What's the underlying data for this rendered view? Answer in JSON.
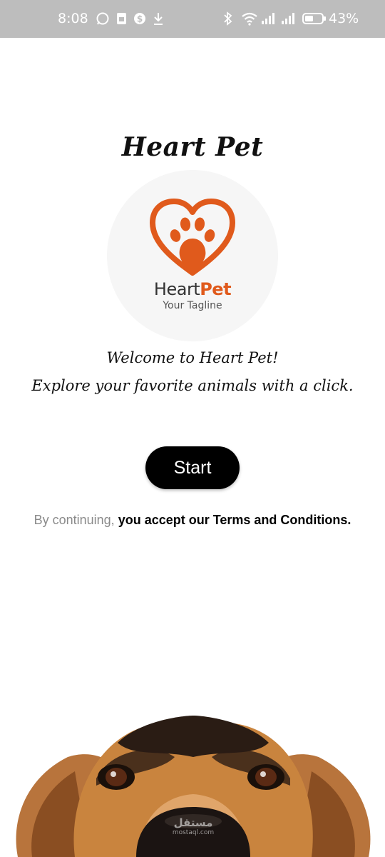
{
  "status_bar": {
    "time": "8:08",
    "battery": "43%",
    "icons": [
      "whatsapp-icon",
      "sim-icon",
      "s-icon",
      "download-icon",
      "bluetooth-icon",
      "wifi-icon",
      "signal-icon",
      "signal-icon",
      "battery-icon"
    ]
  },
  "app": {
    "title": "Heart Pet"
  },
  "logo": {
    "word_primary": "Heart",
    "word_accent": "Pet",
    "tagline": "Your Tagline",
    "accent_color": "#e05a1c"
  },
  "welcome": {
    "line1": "Welcome to Heart Pet!",
    "line2": "Explore your favorite animals with a click."
  },
  "start_button": {
    "label": "Start"
  },
  "terms": {
    "prefix": "By continuing,",
    "link": "you accept our Terms and Conditions."
  },
  "watermark": {
    "top": "مستقل",
    "bottom": "mostaql.com"
  }
}
